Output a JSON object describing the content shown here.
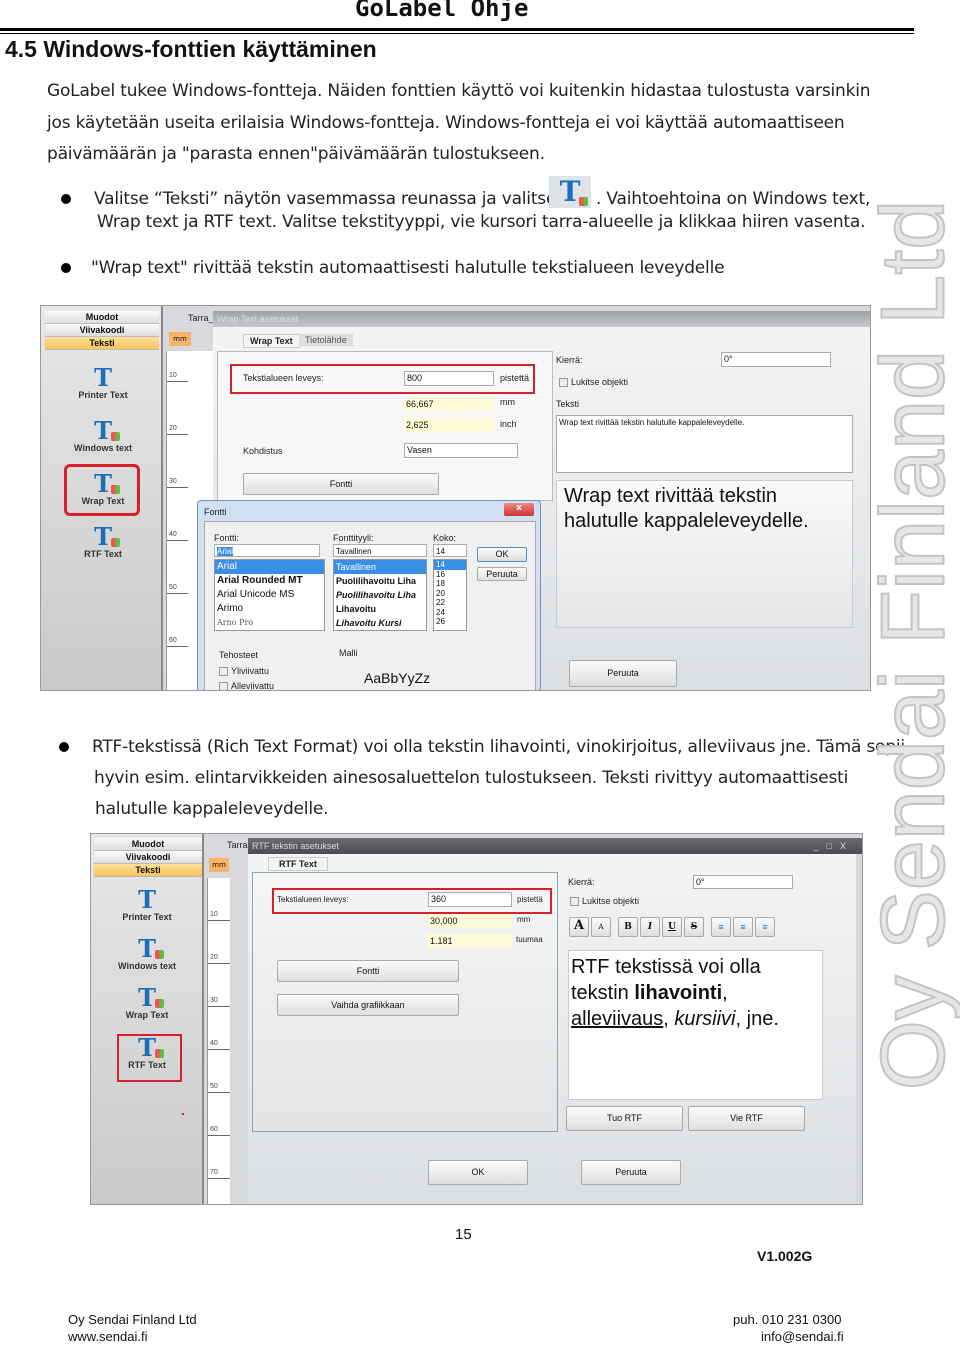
{
  "header": {
    "title": "GoLabel Ohje"
  },
  "section": {
    "title": "4.5  Windows-fonttien käyttäminen"
  },
  "intro": [
    "GoLabel tukee Windows-fontteja. Näiden fonttien käyttö voi kuitenkin hidastaa tulostusta varsinkin",
    "jos käytetään useita erilaisia Windows-fontteja. Windows-fontteja ei voi käyttää automaattiseen",
    "päivämäärän ja \"parasta ennen\"päivämäärän tulostukseen."
  ],
  "bullet1": {
    "line1a": "Valitse “Teksti” näytön vasemmassa reunassa ja valitse",
    "line1b": ". Vaihtoehtoina on Windows text,",
    "line2": "Wrap text ja RTF text. Valitse tekstityyppi, vie kursori tarra-alueelle ja klikkaa hiiren vasenta."
  },
  "bullet2": "\"Wrap text\" rivittää tekstin automaattisesti halutulle tekstialueen leveydelle",
  "bullet3": [
    "RTF-tekstissä (Rich Text Format) voi olla tekstin lihavointi, vinokirjoitus, alleviivaus jne. Tämä sopii",
    "hyvin esim. elintarvikkeiden ainesosaluettelon tulostukseen.  Teksti rivittyy automaattisesti",
    "halutulle kappaleleveydelle."
  ],
  "watermark": "Oy Sendai Finland Ltd",
  "sidebar": {
    "tabs": [
      "Muodot",
      "Viivakoodi",
      "Teksti"
    ],
    "tools": [
      "Printer Text",
      "Windows text",
      "Wrap Text",
      "RTF Text"
    ]
  },
  "shot1": {
    "doc_tab": "Tarra_",
    "unit": "mm",
    "ruler": [
      "10",
      "20",
      "30",
      "40",
      "50",
      "60",
      "70",
      "80",
      "90"
    ],
    "title": "Wrap Text asetukset",
    "tabs": [
      "Wrap Text",
      "Tietolähde"
    ],
    "width_label": "Tekstialueen leveys:",
    "width_value": "800",
    "width_unit": "pistettä",
    "mm_value": "66,667",
    "mm_unit": "mm",
    "inch_value": "2,625",
    "inch_unit": "inch",
    "align_label": "Kohdistus",
    "align_value": "Vasen",
    "font_button": "Fontti",
    "rotate_label": "Kierrä:",
    "rotate_value": "0°",
    "lock_label": "Lukitse objekti",
    "text_label": "Teksti",
    "text_value": "Wrap text rivittää tekstin halutulle kappaleleveydelle.",
    "preview": [
      "Wrap text rivittää tekstin",
      "halutulle kappaleleveydelle."
    ],
    "cancel": "Peruuta",
    "font_dialog": {
      "title": "Fontti",
      "close": "x",
      "font_label": "Fontti:",
      "font_value": "Arial",
      "fonts": [
        "Arial",
        "Arial Rounded MT",
        "Arial Unicode MS",
        "Arimo",
        "Arno Pro"
      ],
      "style_label": "Fonttityyli:",
      "style_value": "Tavallinen",
      "styles": [
        "Tavallinen",
        "Puolilihavoitu Liha",
        "Puolilihavoitu Liha",
        "Lihavoitu",
        "Lihavoitu Kursi"
      ],
      "size_label": "Koko:",
      "size_value": "14",
      "sizes": [
        "14",
        "16",
        "18",
        "20",
        "22",
        "24",
        "26"
      ],
      "ok": "OK",
      "cancel": "Peruuta",
      "effects_label": "Tehosteet",
      "strike": "Yliviivattu",
      "underline": "Alleviivattu",
      "sample_label": "Malli",
      "sample": "AaBbYyZz"
    }
  },
  "shot2": {
    "doc_tab": "Tarra",
    "unit": "mm",
    "ruler": [
      "10",
      "20",
      "30",
      "40",
      "50",
      "60",
      "70"
    ],
    "title": "RTF tekstin asetukset",
    "tab": "RTF Text",
    "width_label": "Tekstialueen leveys:",
    "width_value": "360",
    "width_unit": "pistettä",
    "mm_value": "30,000",
    "mm_unit": "mm",
    "inch_value": "1.181",
    "inch_unit": "tuumaa",
    "font_button": "Fontti",
    "graphic_button": "Vaihda grafiikkaan",
    "rotate_label": "Kierrä:",
    "rotate_value": "0°",
    "lock_label": "Lukitse objekti",
    "toolbar": [
      "A",
      "A",
      "B",
      "I",
      "U",
      "S"
    ],
    "rtf": {
      "t1": "RTF tekstissä voi olla",
      "t2": "tekstin ",
      "bold": "lihavointi",
      "comma": ",",
      "under": "alleviivaus",
      "sep": ", ",
      "ital": "kursiivi",
      "end": ", jne."
    },
    "import": "Tuo RTF",
    "export": "Vie RTF",
    "ok": "OK",
    "cancel": "Peruuta",
    "win_controls": [
      "_",
      "□",
      "X"
    ]
  },
  "page_number": "15",
  "version": "V1.002G",
  "footer": {
    "company": "Oy Sendai Finland Ltd",
    "web": "www.sendai.fi",
    "phone": "puh. 010 231 0300",
    "email": "info@sendai.fi"
  }
}
